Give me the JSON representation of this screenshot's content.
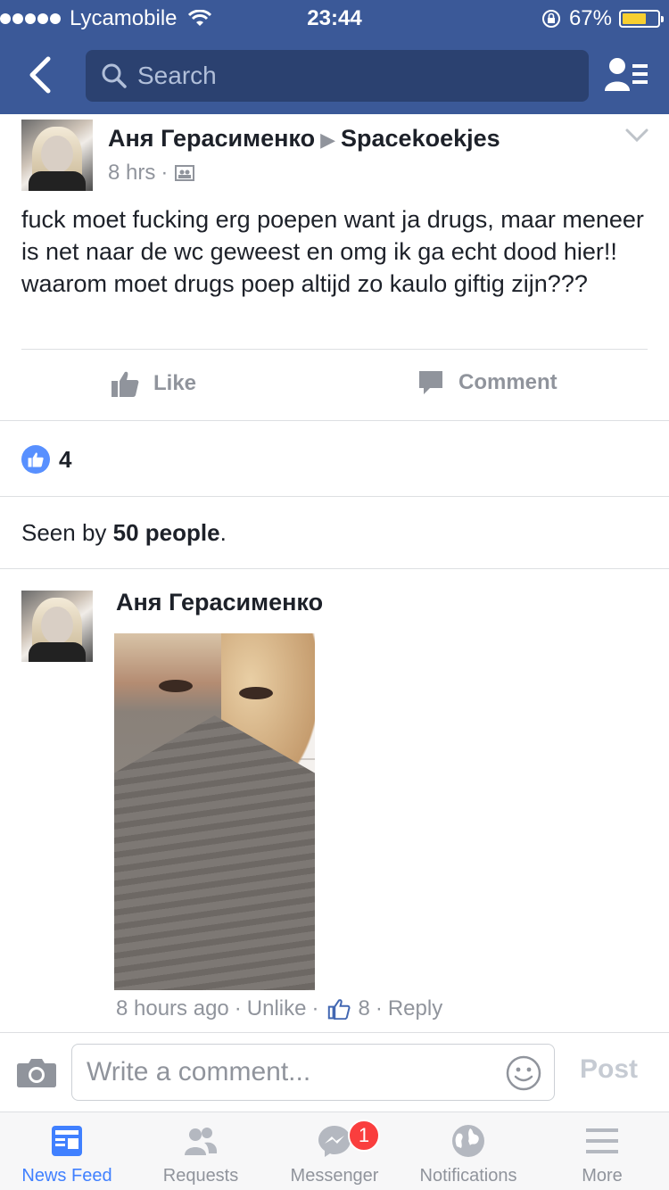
{
  "status_bar": {
    "carrier": "Lycamobile",
    "time": "23:44",
    "battery_percent": "67%",
    "battery_level": 0.67,
    "battery_color": "#f8cf30"
  },
  "navbar": {
    "search_placeholder": "Search",
    "back_icon": "chevron-left-icon",
    "friends_icon": "friends-list-icon",
    "bg_color": "#3b5998"
  },
  "post": {
    "author": "Аня Герасименко",
    "target_group": "Spacekoekjes",
    "time": "8 hrs",
    "separator": "·",
    "text": "fuck moet fucking erg poepen want ja drugs, maar meneer is net naar de wc geweest en omg ik ga echt dood hier!! waarom moet drugs poep altijd zo kaulo giftig zijn???",
    "actions": {
      "like": "Like",
      "comment": "Comment"
    },
    "likes_count": "4",
    "seen_prefix": "Seen by ",
    "seen_count": "50 people",
    "seen_suffix": "."
  },
  "comment": {
    "author": "Аня Герасименко",
    "time": "8 hours ago",
    "sep": "·",
    "unlike": "Unlike",
    "likes": "8",
    "reply": "Reply"
  },
  "composer": {
    "placeholder": "Write a comment...",
    "post_label": "Post"
  },
  "tabbar": {
    "accent": "#4080ff",
    "tabs": [
      {
        "label": "News Feed",
        "icon": "news-feed-icon",
        "active": true
      },
      {
        "label": "Requests",
        "icon": "requests-icon"
      },
      {
        "label": "Messenger",
        "icon": "messenger-icon",
        "badge": "1"
      },
      {
        "label": "Notifications",
        "icon": "globe-icon"
      },
      {
        "label": "More",
        "icon": "menu-icon"
      }
    ]
  }
}
